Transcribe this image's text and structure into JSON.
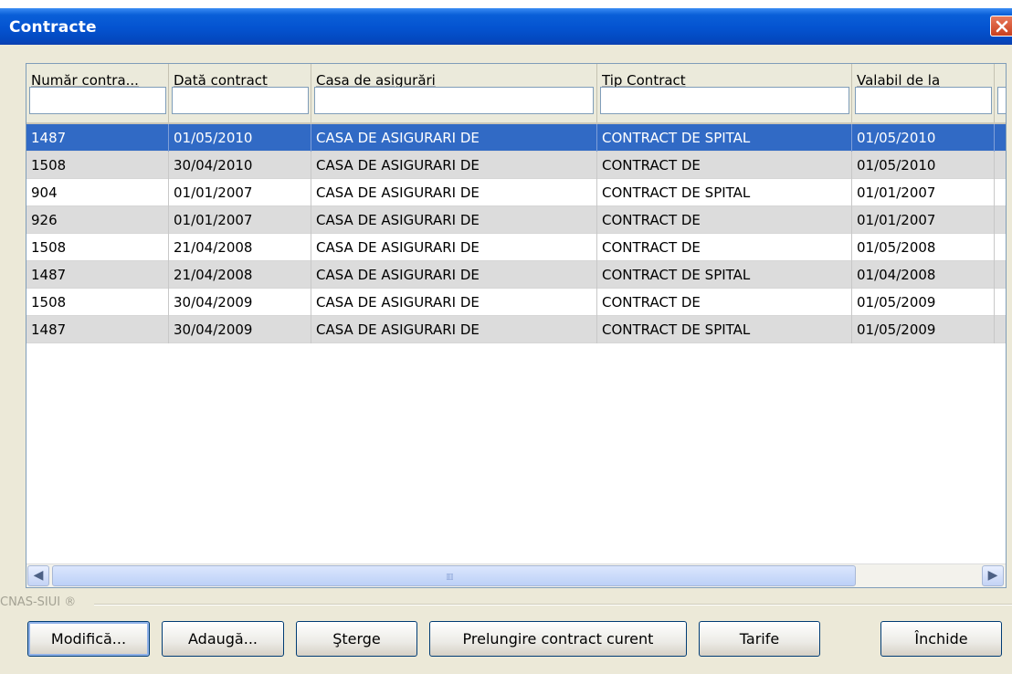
{
  "window": {
    "title": "Contracte"
  },
  "table": {
    "columns": [
      "Număr contra...",
      "Dată contract",
      "Casa de asigurări",
      "Tip Contract",
      "Valabil de la"
    ],
    "rows": [
      [
        "1487",
        "01/05/2010",
        "CASA DE ASIGURARI DE",
        "CONTRACT DE SPITAL",
        "01/05/2010"
      ],
      [
        "1508",
        "30/04/2010",
        "CASA DE ASIGURARI DE",
        "CONTRACT DE",
        "01/05/2010"
      ],
      [
        "904",
        "01/01/2007",
        "CASA DE ASIGURARI DE",
        "CONTRACT DE SPITAL",
        "01/01/2007"
      ],
      [
        "926",
        "01/01/2007",
        "CASA DE ASIGURARI DE",
        "CONTRACT DE",
        "01/01/2007"
      ],
      [
        "1508",
        "21/04/2008",
        "CASA DE ASIGURARI DE",
        "CONTRACT DE",
        "01/05/2008"
      ],
      [
        "1487",
        "21/04/2008",
        "CASA DE ASIGURARI DE",
        "CONTRACT DE SPITAL",
        "01/04/2008"
      ],
      [
        "1508",
        "30/04/2009",
        "CASA DE ASIGURARI DE",
        "CONTRACT DE",
        "01/05/2009"
      ],
      [
        "1487",
        "30/04/2009",
        "CASA DE ASIGURARI DE",
        "CONTRACT DE SPITAL",
        "01/05/2009"
      ]
    ],
    "selected_row": 0
  },
  "footer": {
    "brand": "CNAS-SIUI ®",
    "buttons": {
      "modify": "Modifică...",
      "add": "Adaugă...",
      "delete": "Şterge",
      "extend": "Prelungire contract curent",
      "tariffs": "Tarife",
      "close": "Închide"
    }
  },
  "colors": {
    "title_bar": "#0453d0",
    "selection": "#316ac5",
    "alt_row": "#dcdcdc",
    "close_button": "#d9532f"
  }
}
